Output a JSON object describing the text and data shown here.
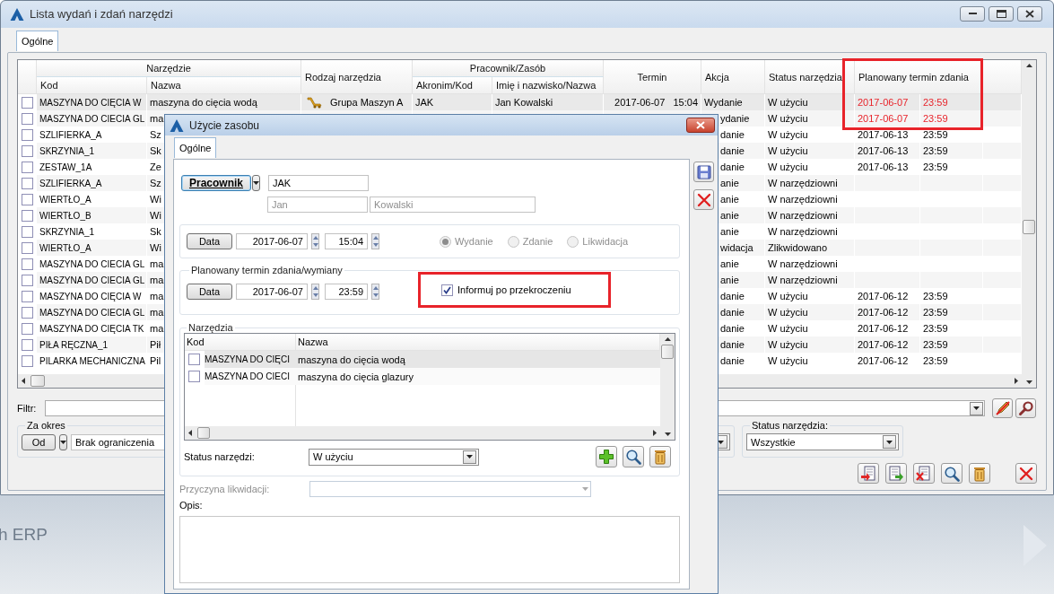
{
  "window": {
    "title": "Lista wydań i zdań narzędzi"
  },
  "tabs": [
    {
      "label": "Ogólne",
      "selected": true
    }
  ],
  "table": {
    "column_groups": [
      {
        "label": "Narzędzie",
        "kind": "group",
        "columns": [
          "Kod",
          "Nazwa"
        ]
      },
      {
        "label": "Rodzaj narzędzia",
        "kind": "single"
      },
      {
        "label": "Pracownik/Zasób",
        "kind": "group",
        "columns": [
          "Akronim/Kod",
          "Imię i nazwisko/Nazwa"
        ]
      },
      {
        "label": "Termin",
        "kind": "single"
      },
      {
        "label": "Akcja",
        "kind": "single"
      },
      {
        "label": "Status narzędzia",
        "kind": "single"
      },
      {
        "label": "Planowany termin zdania",
        "kind": "date-time",
        "highlighted": true
      }
    ],
    "rows": [
      {
        "kind": "full",
        "selected": true,
        "checked": false,
        "kod": "MASZYNA DO CIĘCIA W",
        "nazwa": "maszyna do cięcia wodą",
        "rodzaj": "Grupa Maszyn A",
        "akronim": "JAK",
        "imie": "Jan Kowalski",
        "termin": "2017-06-07   15:04",
        "akcja": "Wydanie",
        "status": "W użyciu",
        "plan_date": "2017-06-07",
        "plan_time": "23:59",
        "overdue": true
      },
      {
        "kind": "partial",
        "selected": false,
        "checked": false,
        "kod": "MASZYNA DO CIECIA GL",
        "nazwa": "ma",
        "akcja": "ydanie",
        "status": "W użyciu",
        "plan_date": "2017-06-07",
        "plan_time": "23:59",
        "overdue": true
      },
      {
        "kind": "partial",
        "selected": false,
        "checked": false,
        "kod": "SZLIFIERKA_A",
        "nazwa": "Sz",
        "akcja": "danie",
        "status": "W użyciu",
        "plan_date": "2017-06-13",
        "plan_time": "23:59",
        "overdue": false
      },
      {
        "kind": "partial",
        "selected": false,
        "checked": false,
        "kod": "SKRZYNIA_1",
        "nazwa": "Sk",
        "akcja": "danie",
        "status": "W użyciu",
        "plan_date": "2017-06-13",
        "plan_time": "23:59",
        "overdue": false
      },
      {
        "kind": "partial",
        "selected": false,
        "checked": false,
        "kod": "ZESTAW_1A",
        "nazwa": "Ze",
        "akcja": "danie",
        "status": "W użyciu",
        "plan_date": "2017-06-13",
        "plan_time": "23:59",
        "overdue": false
      },
      {
        "kind": "partial",
        "selected": false,
        "checked": false,
        "kod": "SZLIFIERKA_A",
        "nazwa": "Sz",
        "akcja": "anie",
        "status": "W narzędziowni"
      },
      {
        "kind": "partial",
        "selected": false,
        "checked": false,
        "kod": "WIERTŁO_A",
        "nazwa": "Wi",
        "akcja": "anie",
        "status": "W narzędziowni"
      },
      {
        "kind": "partial",
        "selected": false,
        "checked": false,
        "kod": "WIERTŁO_B",
        "nazwa": "Wi",
        "akcja": "anie",
        "status": "W narzędziowni"
      },
      {
        "kind": "partial",
        "selected": false,
        "checked": false,
        "kod": "SKRZYNIA_1",
        "nazwa": "Sk",
        "akcja": "anie",
        "status": "W narzędziowni"
      },
      {
        "kind": "partial",
        "selected": false,
        "checked": false,
        "kod": "WIERTŁO_A",
        "nazwa": "Wi",
        "akcja": "widacja",
        "status": "Zlikwidowano"
      },
      {
        "kind": "partial",
        "selected": false,
        "checked": false,
        "kod": "MASZYNA DO CIECIA GL",
        "nazwa": "ma",
        "akcja": "anie",
        "status": "W narzędziowni"
      },
      {
        "kind": "partial",
        "selected": false,
        "checked": false,
        "kod": "MASZYNA DO CIECIA GL",
        "nazwa": "ma",
        "akcja": "anie",
        "status": "W narzędziowni"
      },
      {
        "kind": "partial",
        "selected": false,
        "checked": false,
        "kod": "MASZYNA DO CIĘCIA W",
        "nazwa": "ma",
        "akcja": "danie",
        "status": "W użyciu",
        "plan_date": "2017-06-12",
        "plan_time": "23:59",
        "overdue": false
      },
      {
        "kind": "partial",
        "selected": false,
        "checked": false,
        "kod": "MASZYNA DO CIECIA GL",
        "nazwa": "ma",
        "akcja": "danie",
        "status": "W użyciu",
        "plan_date": "2017-06-12",
        "plan_time": "23:59",
        "overdue": false
      },
      {
        "kind": "partial",
        "selected": false,
        "checked": false,
        "kod": "MASZYNA DO CIĘCIA TK",
        "nazwa": "ma",
        "akcja": "danie",
        "status": "W użyciu",
        "plan_date": "2017-06-12",
        "plan_time": "23:59",
        "overdue": false
      },
      {
        "kind": "partial",
        "selected": false,
        "checked": false,
        "kod": "PIŁA RĘCZNA_1",
        "nazwa": "Pił",
        "akcja": "danie",
        "status": "W użyciu",
        "plan_date": "2017-06-12",
        "plan_time": "23:59",
        "overdue": false
      },
      {
        "kind": "partial",
        "selected": false,
        "checked": false,
        "kod": "PILARKA MECHANICZNA",
        "nazwa": "Pil",
        "akcja": "danie",
        "status": "W użyciu",
        "plan_date": "2017-06-12",
        "plan_time": "23:59",
        "overdue": false
      }
    ]
  },
  "filter": {
    "label": "Filtr:"
  },
  "period": {
    "title": "Za okres",
    "button": "Od",
    "value": "Brak ograniczenia"
  },
  "status_filter": {
    "title": "Status narzędzia:",
    "value": "Wszystkie"
  },
  "desktop_text": "h ERP",
  "dialog": {
    "title": "Użycie zasobu",
    "tabs": [
      {
        "label": "Ogólne",
        "selected": true
      }
    ],
    "resource_button": "Pracownik",
    "acronym": "JAK",
    "first_name": {
      "value": "Jan",
      "disabled": true
    },
    "last_name": {
      "value": "Kowalski",
      "disabled": true
    },
    "issue": {
      "button": "Data",
      "date": "2017-06-07",
      "time": "15:04",
      "actions": [
        {
          "label": "Wydanie",
          "selected": true,
          "disabled": true
        },
        {
          "label": "Zdanie",
          "selected": false,
          "disabled": true
        },
        {
          "label": "Likwidacja",
          "selected": false,
          "disabled": true
        }
      ]
    },
    "planned": {
      "title": "Planowany termin zdania/wymiany",
      "button": "Data",
      "date": "2017-06-07",
      "time": "23:59",
      "notify": {
        "label": "Informuj po przekroczeniu",
        "checked": true,
        "highlighted": true
      }
    },
    "tools": {
      "title": "Narzędzia",
      "columns": [
        "Kod",
        "Nazwa"
      ],
      "rows": [
        {
          "kod": "MASZYNA DO CIĘCI",
          "nazwa": "maszyna do cięcia wodą",
          "checked": false,
          "selected": true
        },
        {
          "kod": "MASZYNA DO CIECI",
          "nazwa": "maszyna do cięcia glazury",
          "checked": false,
          "selected": false
        }
      ]
    },
    "status": {
      "label": "Status narzędzi:",
      "value": "W użyciu"
    },
    "reason": {
      "label": "Przyczyna likwidacji:",
      "disabled": true
    },
    "description": {
      "label": "Opis:"
    }
  }
}
